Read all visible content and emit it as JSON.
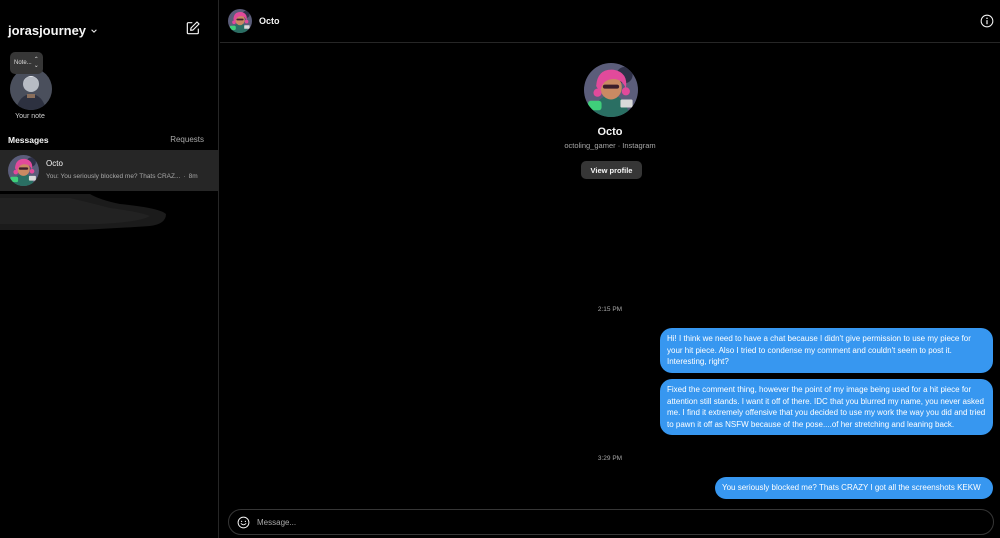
{
  "sidebar": {
    "account_name": "jorasjourney",
    "note": {
      "bubble_text": "Note...",
      "label": "Your note"
    },
    "messages_heading": "Messages",
    "requests_label": "Requests",
    "threads": [
      {
        "name": "Octo",
        "preview": "You: You seriously blocked me? Thats CRAZ...",
        "separator": "·",
        "time": "8m"
      }
    ]
  },
  "chat": {
    "header": {
      "name": "Octo"
    },
    "profile": {
      "name": "Octo",
      "subtitle": "octoling_gamer · Instagram",
      "view_profile_label": "View profile"
    },
    "timestamps": [
      "2:15 PM",
      "3:29 PM"
    ],
    "messages": [
      "Hi! I think we need to have a chat because I didn't give permission to use my piece for your hit piece. Also I tried to condense my comment and couldn't seem to post it. Interesting, right?",
      "Fixed the comment thing, however the point of my image being used for a hit piece for attention still stands. I want it off of there. IDC that you blurred my name, you never asked me. I find it extremely offensive that you decided to use my work the way you did and tried to pawn it off as NSFW because of the pose....of her stretching and leaning back.",
      "You seriously blocked me? Thats CRAZY I got all the screenshots KEKW"
    ],
    "composer": {
      "placeholder": "Message..."
    }
  },
  "colors": {
    "bubble": "#3797f0",
    "background": "#000000",
    "selected_thread": "#262626",
    "secondary_text": "#a8a8a8"
  },
  "icons": [
    "chevron-down-icon",
    "compose-icon",
    "info-icon",
    "emoji-icon"
  ]
}
